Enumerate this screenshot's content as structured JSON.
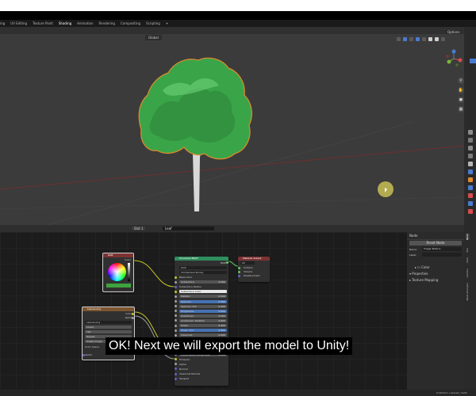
{
  "workspace_tabs": [
    {
      "label": "Modeling",
      "active": false
    },
    {
      "label": "UV Editing",
      "active": false
    },
    {
      "label": "Texture Paint",
      "active": false
    },
    {
      "label": "Shading",
      "active": true
    },
    {
      "label": "Animation",
      "active": false
    },
    {
      "label": "Rendering",
      "active": false
    },
    {
      "label": "Compositing",
      "active": false
    },
    {
      "label": "Scripting",
      "active": false
    },
    {
      "label": "+",
      "active": false
    }
  ],
  "viewport": {
    "orientation": "Global",
    "options_label": "Options"
  },
  "node_editor": {
    "slot": "Slot 1",
    "material": "Leaf"
  },
  "nodes": {
    "rgb": {
      "title": "RGB",
      "output": "Color",
      "color": "#3da33d"
    },
    "image_texture": {
      "title": "Leaves.png",
      "outputs": [
        "Color",
        "Alpha"
      ],
      "image": "Leaves.png",
      "interpolation": "Linear",
      "projection": "Flat",
      "extension": "Repeat",
      "source": "Single Image",
      "color_space_label": "Color Space",
      "vector_label": "Vector"
    },
    "principled_bsdf": {
      "title": "Principled BSDF",
      "output": "BSDF",
      "distribution": "GGX",
      "subsurface_method": "Christensen-Burley",
      "inputs": [
        {
          "label": "Base Color",
          "value": "",
          "style": "socket"
        },
        {
          "label": "Subsurface",
          "value": "0.000",
          "style": "grey"
        },
        {
          "label": "Subsurface Radius",
          "value": "",
          "style": "socket"
        },
        {
          "label": "Subsurface Color",
          "value": "",
          "style": "white"
        },
        {
          "label": "Metallic",
          "value": "0.000",
          "style": "grey"
        },
        {
          "label": "Specular",
          "value": "0.500",
          "style": "blue"
        },
        {
          "label": "Specular Tint",
          "value": "0.000",
          "style": "grey"
        },
        {
          "label": "Roughness",
          "value": "0.500",
          "style": "blue"
        },
        {
          "label": "Anisotropic",
          "value": "0.000",
          "style": "grey"
        },
        {
          "label": "Anisotropic Rotation",
          "value": "0.000",
          "style": "grey"
        },
        {
          "label": "Sheen",
          "value": "0.000",
          "style": "grey"
        },
        {
          "label": "Sheen Tint",
          "value": "0.500",
          "style": "blue"
        },
        {
          "label": "Clearcoat",
          "value": "0.000",
          "style": "grey"
        },
        {
          "label": "Clearcoat Roughness",
          "value": "0.030",
          "style": "grey"
        },
        {
          "label": "IOR",
          "value": "1.450",
          "style": "grey"
        },
        {
          "label": "Transmission",
          "value": "0.000",
          "style": "grey"
        },
        {
          "label": "Transmission Roughness",
          "value": "0.000",
          "style": "grey"
        },
        {
          "label": "Emission",
          "value": "",
          "style": "socket"
        },
        {
          "label": "Alpha",
          "value": "",
          "style": "socket"
        },
        {
          "label": "Normal",
          "value": "",
          "style": "socket"
        },
        {
          "label": "Clearcoat Normal",
          "value": "",
          "style": "socket"
        },
        {
          "label": "Tangent",
          "value": "",
          "style": "socket"
        }
      ]
    },
    "material_output": {
      "title": "Material Output",
      "target": "All",
      "inputs": [
        "Surface",
        "Volume",
        "Displacement"
      ]
    }
  },
  "sidebar_panel": {
    "title": "Node",
    "reset_button": "Reset Node",
    "name_label": "Name:",
    "name_value": "Image Texture",
    "label_label": "Label:",
    "label_value": "",
    "color_section": "Color",
    "properties_section": "Properties",
    "texture_mapping_section": "Texture Mapping",
    "tabs": [
      "Node",
      "Tool",
      "View",
      "Options",
      "Node Wrangler"
    ]
  },
  "status": {
    "text": "Collection | Leaves | Verts"
  },
  "subtitle": "OK! Next we will export the model to Unity!",
  "colors": {
    "viewport_bg": "#3b3b3b",
    "node_editor_bg": "#1c1c1c",
    "accent_blue": "#4b7bd1",
    "leaf_green": "#3da33d",
    "selection_orange": "#e08a2c"
  }
}
